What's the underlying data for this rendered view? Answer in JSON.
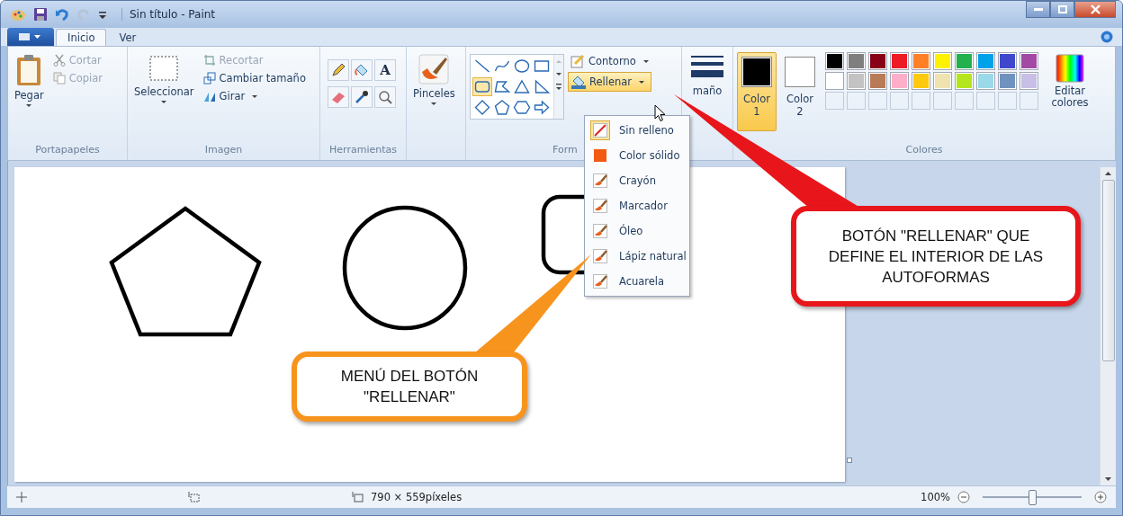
{
  "window": {
    "title": "Sin título - Paint"
  },
  "tabs": [
    {
      "label": "Inicio",
      "selected": true
    },
    {
      "label": "Ver",
      "selected": false
    }
  ],
  "ribbon": {
    "clipboard": {
      "label": "Portapapeles",
      "paste": "Pegar",
      "items": [
        {
          "label": "Cortar",
          "disabled": true
        },
        {
          "label": "Copiar",
          "disabled": true
        }
      ]
    },
    "image": {
      "label": "Imagen",
      "select": "Seleccionar",
      "items": [
        {
          "label": "Recortar",
          "disabled": true
        },
        {
          "label": "Cambiar tamaño",
          "disabled": false
        },
        {
          "label": "Girar",
          "disabled": false
        }
      ]
    },
    "tools": {
      "label": "Herramientas",
      "items": [
        {
          "kind": "pencil"
        },
        {
          "kind": "fill"
        },
        {
          "kind": "text",
          "label": "A"
        },
        {
          "kind": "eraser"
        },
        {
          "kind": "picker"
        },
        {
          "kind": "magnifier"
        }
      ]
    },
    "brushes": {
      "label": "Pinceles"
    },
    "shapes": {
      "label": "Form",
      "gallery": [
        {
          "kind": "line",
          "selected": false
        },
        {
          "kind": "curve",
          "selected": false
        },
        {
          "kind": "oval",
          "selected": false
        },
        {
          "kind": "rect",
          "selected": false
        },
        {
          "kind": "roundrect",
          "selected": true
        },
        {
          "kind": "polygon",
          "selected": false
        },
        {
          "kind": "triangle",
          "selected": false
        },
        {
          "kind": "righttriangle",
          "selected": false
        },
        {
          "kind": "diamond",
          "selected": false
        },
        {
          "kind": "pentagon",
          "selected": false
        },
        {
          "kind": "hexagon",
          "selected": false
        },
        {
          "kind": "arrow",
          "selected": false
        }
      ],
      "outline": "Contorno",
      "fill": {
        "label": "Rellenar",
        "open": true
      }
    },
    "size": {
      "label": "maño"
    },
    "colors": {
      "label": "Colores",
      "color1": {
        "label": "Color",
        "number": "1",
        "selected": true,
        "color": "#000000"
      },
      "color2": {
        "label": "Color",
        "number": "2",
        "selected": false,
        "color": "#ffffff"
      },
      "palette": [
        {
          "kind": "color",
          "color": "#000000"
        },
        {
          "kind": "color",
          "color": "#7f7f7f"
        },
        {
          "kind": "color",
          "color": "#880015"
        },
        {
          "kind": "color",
          "color": "#ed1c24"
        },
        {
          "kind": "color",
          "color": "#ff7f27"
        },
        {
          "kind": "color",
          "color": "#fff200"
        },
        {
          "kind": "color",
          "color": "#22b14c"
        },
        {
          "kind": "color",
          "color": "#00a2e8"
        },
        {
          "kind": "color",
          "color": "#3f48cc"
        },
        {
          "kind": "color",
          "color": "#a349a4"
        },
        {
          "kind": "color",
          "color": "#ffffff"
        },
        {
          "kind": "color",
          "color": "#c3c3c3"
        },
        {
          "kind": "color",
          "color": "#b97a57"
        },
        {
          "kind": "color",
          "color": "#ffaec9"
        },
        {
          "kind": "color",
          "color": "#ffc90e"
        },
        {
          "kind": "color",
          "color": "#efe4b0"
        },
        {
          "kind": "color",
          "color": "#b5e61d"
        },
        {
          "kind": "color",
          "color": "#99d9ea"
        },
        {
          "kind": "color",
          "color": "#7092be"
        },
        {
          "kind": "color",
          "color": "#c8bfe7"
        },
        {
          "kind": "empty"
        },
        {
          "kind": "empty"
        },
        {
          "kind": "empty"
        },
        {
          "kind": "empty"
        },
        {
          "kind": "empty"
        },
        {
          "kind": "empty"
        },
        {
          "kind": "empty"
        },
        {
          "kind": "empty"
        },
        {
          "kind": "empty"
        },
        {
          "kind": "empty"
        }
      ],
      "edit": "Editar colores"
    }
  },
  "fill_menu": {
    "items": [
      {
        "label": "Sin relleno",
        "kind": "none",
        "selected": true
      },
      {
        "label": "Color sólido",
        "kind": "solid",
        "selected": false
      },
      {
        "label": "Crayón",
        "kind": "brush",
        "selected": false
      },
      {
        "label": "Marcador",
        "kind": "brush",
        "selected": false
      },
      {
        "label": "Óleo",
        "kind": "brush",
        "selected": false
      },
      {
        "label": "Lápiz natural",
        "kind": "brush",
        "selected": false
      },
      {
        "label": "Acuarela",
        "kind": "brush",
        "selected": false
      }
    ]
  },
  "callouts": [
    {
      "text": "BOTÓN \"RELLENAR\" QUE DEFINE EL INTERIOR DE LAS AUTOFORMAS",
      "color": "#e8161b"
    },
    {
      "text": "MENÚ DEL BOTÓN \"RELLENAR\"",
      "color": "#f7941d"
    }
  ],
  "status_bar": {
    "size": "790 × 559píxeles",
    "zoom": "100%",
    "zoom_slider": {
      "level": 0.5
    }
  }
}
